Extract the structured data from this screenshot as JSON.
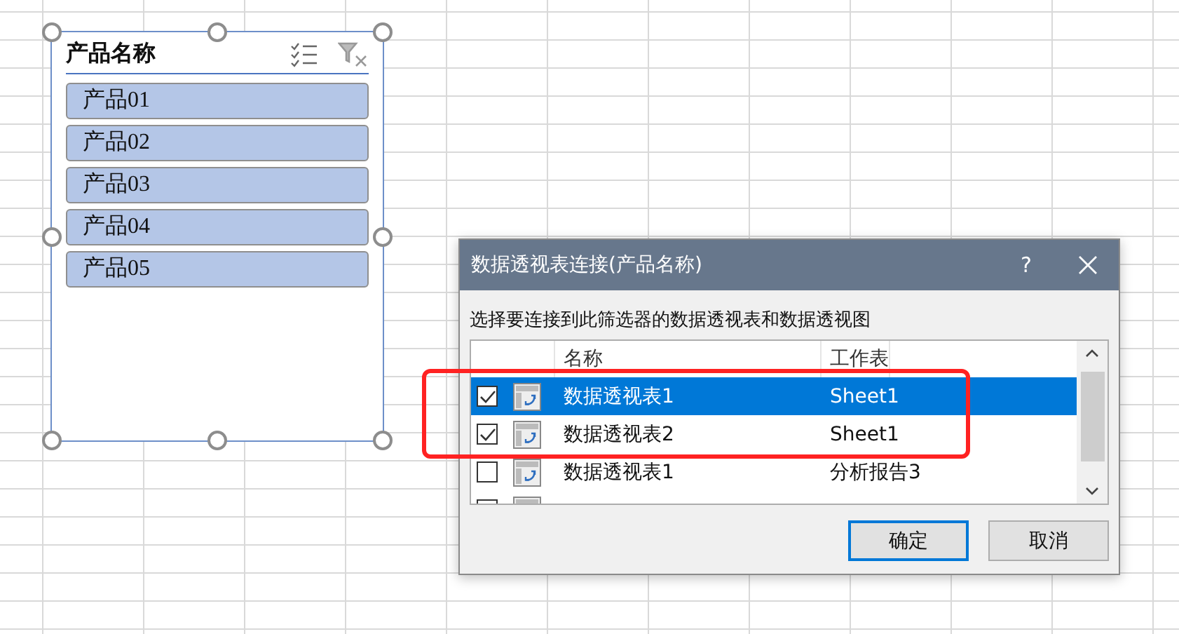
{
  "slicer": {
    "title": "产品名称",
    "items": [
      {
        "label": "产品01",
        "selected": true
      },
      {
        "label": "产品02",
        "selected": true
      },
      {
        "label": "产品03",
        "selected": true
      },
      {
        "label": "产品04",
        "selected": true
      },
      {
        "label": "产品05",
        "selected": true
      }
    ]
  },
  "dialog": {
    "title": "数据透视表连接(产品名称)",
    "help": "?",
    "instruction": "选择要连接到此筛选器的数据透视表和数据透视图",
    "columns": [
      "名称",
      "工作表"
    ],
    "rows": [
      {
        "name": "数据透视表1",
        "sheet": "Sheet1",
        "checked": true,
        "selected": true
      },
      {
        "name": "数据透视表2",
        "sheet": "Sheet1",
        "checked": true,
        "selected": false
      },
      {
        "name": "数据透视表1",
        "sheet": "分析报告3",
        "checked": false,
        "selected": false
      },
      {
        "selected": false
      }
    ],
    "buttons": [
      {
        "label": "确定",
        "kind": "default"
      },
      {
        "label": "取消",
        "kind": "normal"
      }
    ]
  },
  "annotation": {
    "kind": "outline"
  }
}
